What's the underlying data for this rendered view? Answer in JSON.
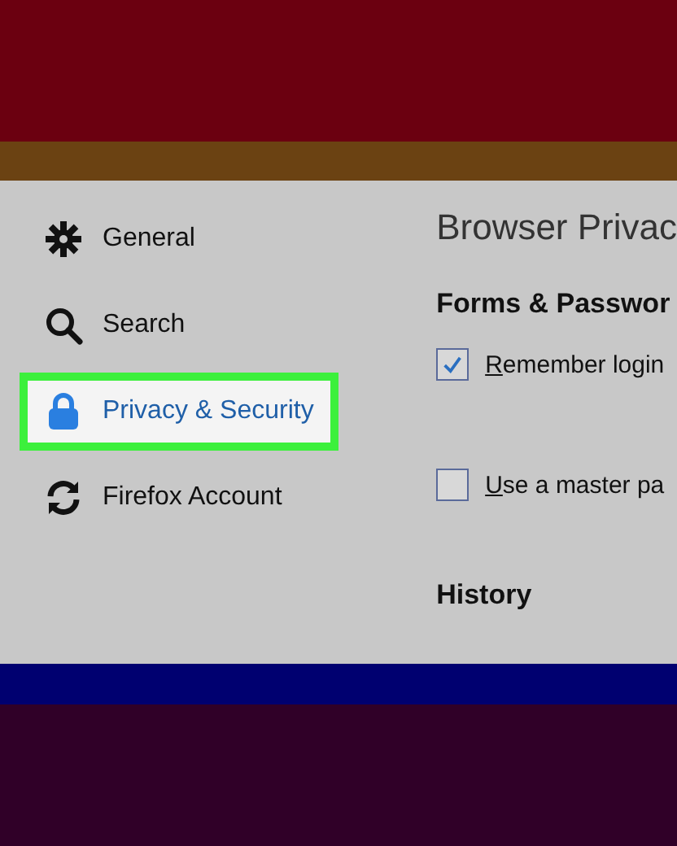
{
  "sidebar": {
    "items": [
      {
        "kind": "gear",
        "label": "General",
        "selected": false
      },
      {
        "kind": "search",
        "label": "Search",
        "selected": false
      },
      {
        "kind": "lock",
        "label": "Privacy & Security",
        "selected": true
      },
      {
        "kind": "sync",
        "label": "Firefox Account",
        "selected": false
      }
    ]
  },
  "content": {
    "title": "Browser Privac",
    "sections": [
      {
        "heading": "Forms & Passwor",
        "options": [
          {
            "label": "Remember login",
            "checked": true
          },
          {
            "label": "Use a master pa",
            "checked": false
          }
        ]
      },
      {
        "heading": "History"
      }
    ]
  }
}
